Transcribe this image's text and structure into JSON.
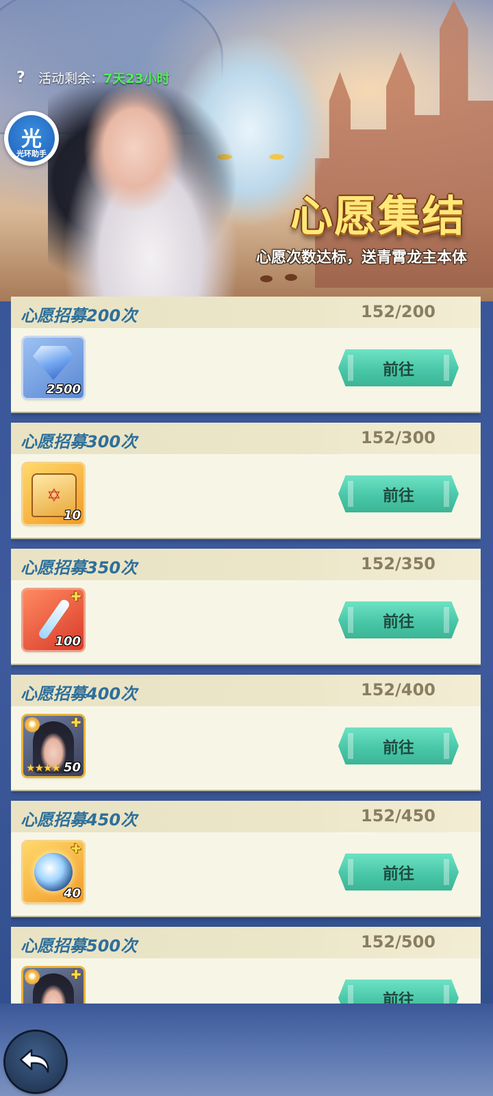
{
  "header": {
    "help_icon": "question-mark-icon",
    "remaining_label": "活动剩余：",
    "remaining_value": "7天23小时",
    "assistant_char": "光",
    "assistant_text": "光环助手"
  },
  "banner": {
    "title": "心愿集结",
    "subtitle": "心愿次数达标，送青霄龙主本体"
  },
  "colors": {
    "title_text": "#2e6f9a",
    "progress_text": "#8a7d62",
    "button": "#49c7a8",
    "remaining_value": "#53f05a"
  },
  "tasks": [
    {
      "title": "心愿招募200次",
      "progress": "152/200",
      "reward_icon": "diamond-gem-icon",
      "reward_qty": "2500",
      "button": "前往"
    },
    {
      "title": "心愿招募300次",
      "progress": "152/300",
      "reward_icon": "summon-scroll-icon",
      "reward_qty": "10",
      "button": "前往"
    },
    {
      "title": "心愿招募350次",
      "progress": "152/350",
      "reward_icon": "crystal-wand-icon",
      "reward_qty": "100",
      "button": "前往"
    },
    {
      "title": "心愿招募400次",
      "progress": "152/400",
      "reward_icon": "hero-portrait-icon",
      "reward_qty": "50",
      "button": "前往"
    },
    {
      "title": "心愿招募450次",
      "progress": "152/450",
      "reward_icon": "spirit-orb-icon",
      "reward_qty": "40",
      "button": "前往"
    },
    {
      "title": "心愿招募500次",
      "progress": "152/500",
      "reward_icon": "hero-portrait-icon",
      "reward_qty": "",
      "button": "前往"
    }
  ],
  "footer": {
    "back_icon": "back-arrow-icon"
  }
}
